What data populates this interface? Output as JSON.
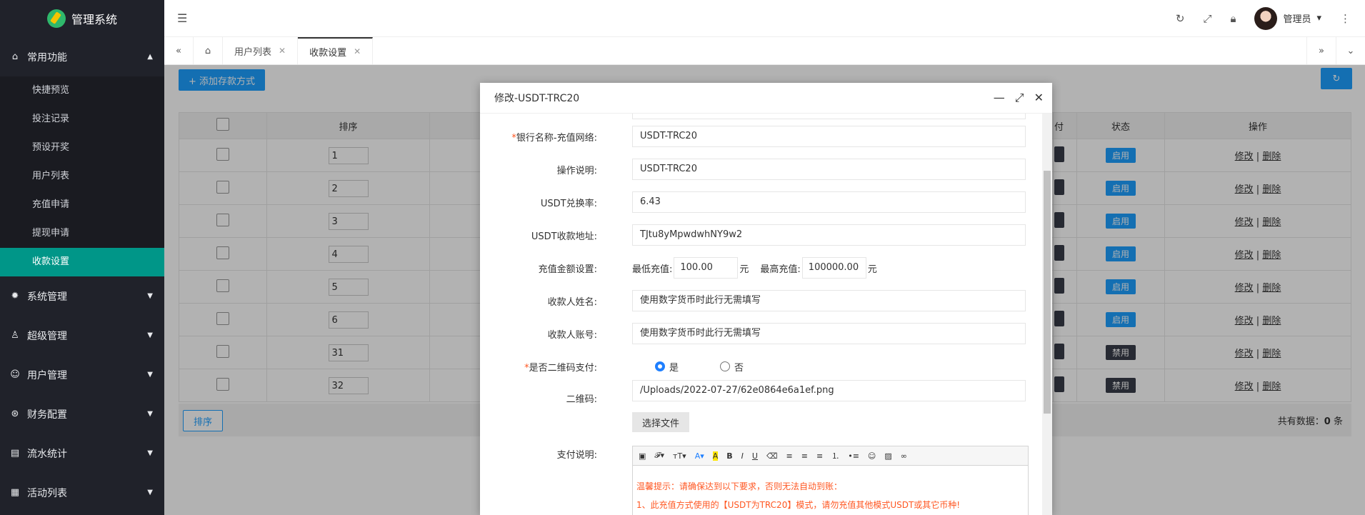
{
  "brand": {
    "title": "管理系统"
  },
  "sidebar": {
    "group_common": "常用功能",
    "items": [
      "快捷预览",
      "投注记录",
      "预设开奖",
      "用户列表",
      "充值申请",
      "提现申请",
      "收款设置"
    ],
    "groups": [
      "系统管理",
      "超级管理",
      "用户管理",
      "财务配置",
      "流水统计",
      "活动列表"
    ]
  },
  "header": {
    "user": "管理员"
  },
  "tabs": [
    "用户列表",
    "收款设置"
  ],
  "toolbar": {
    "add_label": "+ 添加存款方式"
  },
  "table": {
    "headers": [
      "排序",
      "付",
      "状态",
      "操作"
    ],
    "rows": [
      {
        "sort": "1",
        "status": "启用"
      },
      {
        "sort": "2",
        "status": "启用"
      },
      {
        "sort": "3",
        "status": "启用"
      },
      {
        "sort": "4",
        "status": "启用"
      },
      {
        "sort": "5",
        "status": "启用"
      },
      {
        "sort": "6",
        "status": "启用"
      },
      {
        "sort": "31",
        "status": "禁用"
      },
      {
        "sort": "32",
        "status": "禁用"
      }
    ],
    "op_edit": "修改",
    "op_sep": "|",
    "op_delete": "删除"
  },
  "footer": {
    "sort_label": "排序",
    "total_prefix": "共有数据：",
    "total_count": "0",
    "total_suffix": "条"
  },
  "modal": {
    "title": "修改-USDT-TRC20",
    "fields": {
      "bank_label": "银行名称-充值网络:",
      "bank_value": "USDT-TRC20",
      "desc_label": "操作说明:",
      "desc_value": "USDT-TRC20",
      "rate_label": "USDT兑换率:",
      "rate_value": "6.43",
      "addr_label": "USDT收款地址:",
      "addr_value": "TJtu8yMpwdwhNY9w2",
      "amount_label": "充值金额设置:",
      "min_label": "最低充值:",
      "min_value": "100.00",
      "max_label": "最高充值:",
      "max_value": "100000.00",
      "unit": "元",
      "payee_name_label": "收款人姓名:",
      "payee_name_value": "使用数字货币时此行无需填写",
      "payee_acct_label": "收款人账号:",
      "payee_acct_value": "使用数字货币时此行无需填写",
      "qr_pay_label": "是否二维码支付:",
      "yes": "是",
      "no": "否",
      "qr_label": "二维码:",
      "qr_value": "/Uploads/2022-07-27/62e0864e6a1ef.png",
      "choose_file": "选择文件",
      "pay_desc_label": "支付说明:",
      "editor_line1": "温馨提示：请确保达到以下要求，否则无法自动到账：",
      "editor_line2": "1、此充值方式使用的【USDT为TRC20】模式，请勿充值其他模式USDT或其它币种!"
    }
  }
}
